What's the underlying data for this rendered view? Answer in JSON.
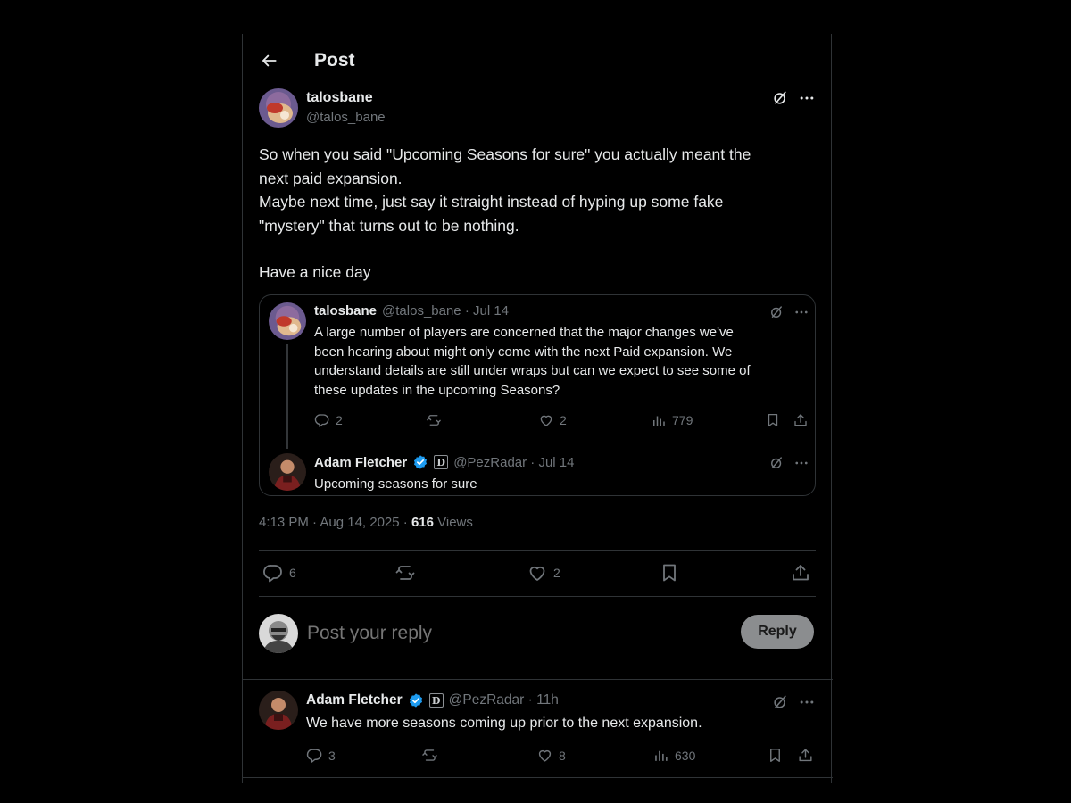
{
  "header": {
    "title": "Post"
  },
  "post": {
    "display_name": "talosbane",
    "handle": "@talos_bane",
    "body_lines": [
      "So when you said \"Upcoming Seasons for sure\" you actually meant the",
      "next paid expansion.",
      "Maybe next time, just say it straight instead of hyping up some fake",
      "\"mystery\" that turns out to be nothing.",
      "Have a nice day"
    ],
    "time": "4:13 PM · Aug 14, 2025 · ",
    "views_count": "616",
    "views_label": " Views",
    "actions": {
      "replies": "6",
      "likes": "2"
    }
  },
  "quote": {
    "first": {
      "display_name": "talosbane",
      "meta": "@talos_bane · Jul 14",
      "text_lines": [
        "A large number of players are concerned that the major changes we've",
        "been hearing about might only come with the next Paid expansion. We",
        "understand details are still under wraps but can we expect to see some of",
        "these updates in the upcoming Seasons?"
      ],
      "replies": "2",
      "likes": "2",
      "views": "779"
    },
    "second": {
      "display_name": "Adam Fletcher",
      "badge_letter": "D",
      "meta": "@PezRadar · Jul 14",
      "text": "Upcoming seasons for sure"
    }
  },
  "composer": {
    "placeholder": "Post your reply",
    "button_label": "Reply"
  },
  "reply": {
    "display_name": "Adam Fletcher",
    "badge_letter": "D",
    "meta": "@PezRadar · 11h",
    "text": "We have more seasons coming up prior to the next expansion.",
    "replies": "3",
    "likes": "8",
    "views": "630"
  },
  "colors": {
    "background": "#000000",
    "text": "#e7e9ea",
    "muted": "#71767b",
    "border": "#2f3336",
    "verified": "#1d9bf0"
  }
}
